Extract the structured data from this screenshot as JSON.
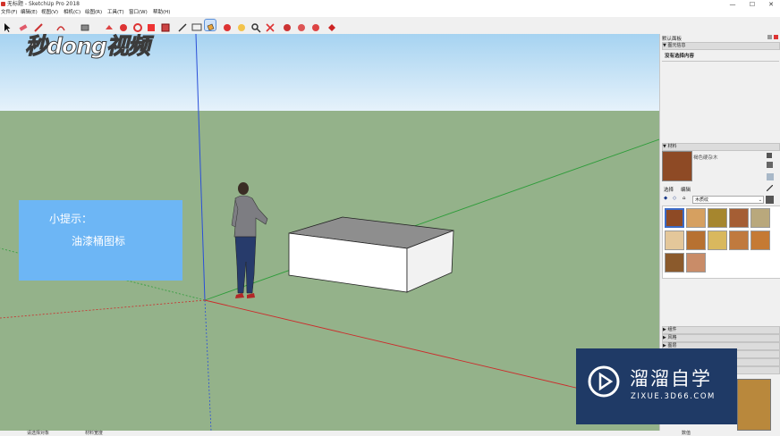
{
  "window": {
    "title": "无标题 - SketchUp Pro 2018",
    "minimize": "—",
    "maximize": "☐",
    "close": "✕"
  },
  "menu": [
    "文件(F)",
    "编辑(E)",
    "视图(V)",
    "相机(C)",
    "绘图(R)",
    "工具(T)",
    "窗口(W)",
    "帮助(H)"
  ],
  "watermark_top": "秒dong视频",
  "tip": {
    "line1": "小提示：",
    "line2": "油漆桶图标"
  },
  "watermark_brand": {
    "name": "溜溜自学",
    "url": "ZIXUE.3D66.COM"
  },
  "tray": {
    "title": "默认面板",
    "entity_info": {
      "header": "图元信息",
      "status": "没有选择内容"
    },
    "materials": {
      "header": "材料",
      "current_name": "褐色硬杂木",
      "tabs": [
        "选择",
        "编辑"
      ],
      "library": "木质纹",
      "swatches": [
        "#8e4a25",
        "#d6a060",
        "#a6862e",
        "#a55e34",
        "#b9a87c",
        "#e4c79a",
        "#b77131",
        "#d9b85e",
        "#c07a3e",
        "#c57a34",
        "#8b5a2c",
        "#c98c68"
      ]
    },
    "collapsed": [
      "组件",
      "风格",
      "图层"
    ]
  },
  "status": {
    "left": "请选择对象",
    "right": "材料宽度",
    "corner": "数值"
  },
  "colors": {
    "sky": "#bfdff4",
    "ground": "#94b28a",
    "tip": "#6db6f5",
    "brand": "#1f3a66"
  }
}
